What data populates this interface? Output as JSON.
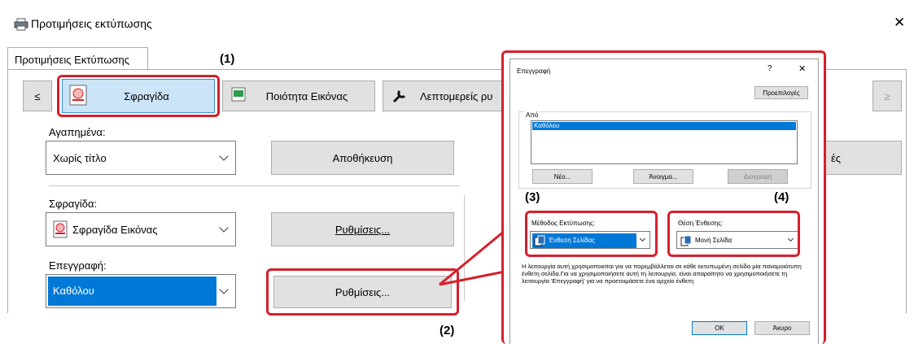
{
  "window": {
    "title": "Προτιμήσεις εκτύπωσης",
    "close_glyph": "✕"
  },
  "tab_label": "Προτιμήσεις Εκτύπωσης",
  "toolbar": {
    "prev_glyph": "≤",
    "next_glyph": "≥",
    "stamp_label": "Σφραγίδα",
    "image_quality_label": "Ποιότητα Εικόνας",
    "details_label": "Λεπτομερείς ρυ"
  },
  "favorites": {
    "label": "Αγαπημένα:",
    "value": "Χωρίς τίτλο",
    "save_button": "Αποθήκευση"
  },
  "stamp": {
    "label": "Σφραγίδα:",
    "value": "Σφραγίδα Εικόνας",
    "settings_button": "Ρυθμίσεις..."
  },
  "overlay": {
    "label": "Επεγγραφή:",
    "value": "Καθόλου",
    "settings_button": "Ρυθμίσεις..."
  },
  "partial_right": "ές",
  "callouts": {
    "c1": "(1)",
    "c2": "(2)",
    "c3": "(3)",
    "c4": "(4)"
  },
  "dialog": {
    "title": "Επεγγραφή",
    "help_glyph": "?",
    "close_glyph": "✕",
    "defaults_button": "Προεπιλογές",
    "from_label": "Από",
    "list_items": [
      "Καθόλου"
    ],
    "new_button": "Νέο...",
    "open_button": "Άνοιγμα...",
    "delete_button": "Διαγραφή",
    "print_method_label": "Μέθοδος Εκτύπωσης:",
    "print_method_value": "Ένθεση Σελίδας",
    "insert_position_label": "Θέση Ένθεσης:",
    "insert_position_value": "Μονή Σελίδα",
    "description": "Η λειτουργία αυτή χρησιμοποιείται για να παρεμβάλλεται σε κάθε εκτυπωμένη σελίδα μία παναμοιότυπη ένθετη σελίδα.Για να χρησιμοποιήσετε αυτή τη λειτουργία, είναι απαραίτητο να χρησιμοποιήσετε τη λειτουργία 'Επεγγραφή' για να προετοιμάσετε ένα αρχείο ένθετη",
    "ok_button": "OK",
    "cancel_button": "Άκυρο"
  },
  "colors": {
    "highlight": "#0078d7",
    "selected_tab_bg": "#cce4f7",
    "callout_red": "#d6202c"
  }
}
